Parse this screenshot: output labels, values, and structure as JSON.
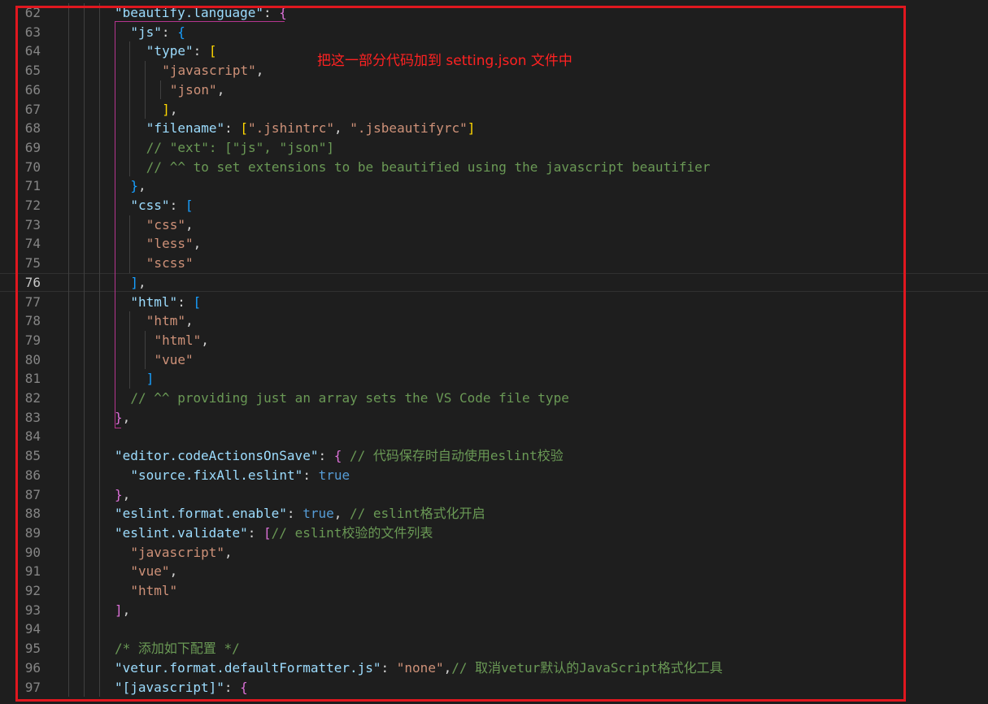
{
  "editor": {
    "current_line": 76,
    "lines": [
      {
        "n": 62,
        "indent": 0,
        "tokens": [
          [
            "k",
            "\"beautify.language\""
          ],
          [
            "p",
            ": "
          ],
          [
            "br2",
            "{"
          ]
        ]
      },
      {
        "n": 63,
        "indent": 1,
        "tokens": [
          [
            "k",
            "\"js\""
          ],
          [
            "p",
            ": "
          ],
          [
            "br3",
            "{"
          ]
        ]
      },
      {
        "n": 64,
        "indent": 2,
        "tokens": [
          [
            "k",
            "\"type\""
          ],
          [
            "p",
            ": "
          ],
          [
            "br1",
            "["
          ]
        ]
      },
      {
        "n": 65,
        "indent": 3,
        "tokens": [
          [
            "s",
            "\"javascript\""
          ],
          [
            "p",
            ","
          ]
        ]
      },
      {
        "n": 66,
        "indent": 3.5,
        "tokens": [
          [
            "s",
            "\"json\""
          ],
          [
            "p",
            ","
          ]
        ]
      },
      {
        "n": 67,
        "indent": 3,
        "tokens": [
          [
            "br1",
            "]"
          ],
          [
            "p",
            ","
          ]
        ]
      },
      {
        "n": 68,
        "indent": 2,
        "tokens": [
          [
            "k",
            "\"filename\""
          ],
          [
            "p",
            ": "
          ],
          [
            "br1",
            "["
          ],
          [
            "s",
            "\".jshintrc\""
          ],
          [
            "p",
            ", "
          ],
          [
            "s",
            "\".jsbeautifyrc\""
          ],
          [
            "br1",
            "]"
          ]
        ]
      },
      {
        "n": 69,
        "indent": 2,
        "tokens": [
          [
            "c",
            "// \"ext\": [\"js\", \"json\"]"
          ]
        ]
      },
      {
        "n": 70,
        "indent": 2,
        "tokens": [
          [
            "c",
            "// ^^ to set extensions to be beautified using the javascript beautifier"
          ]
        ]
      },
      {
        "n": 71,
        "indent": 1,
        "tokens": [
          [
            "br3",
            "}"
          ],
          [
            "p",
            ","
          ]
        ]
      },
      {
        "n": 72,
        "indent": 1,
        "tokens": [
          [
            "k",
            "\"css\""
          ],
          [
            "p",
            ": "
          ],
          [
            "br3",
            "["
          ]
        ]
      },
      {
        "n": 73,
        "indent": 2,
        "tokens": [
          [
            "s",
            "\"css\""
          ],
          [
            "p",
            ","
          ]
        ]
      },
      {
        "n": 74,
        "indent": 2,
        "tokens": [
          [
            "s",
            "\"less\""
          ],
          [
            "p",
            ","
          ]
        ]
      },
      {
        "n": 75,
        "indent": 2,
        "tokens": [
          [
            "s",
            "\"scss\""
          ]
        ]
      },
      {
        "n": 76,
        "indent": 1,
        "tokens": [
          [
            "br3",
            "]"
          ],
          [
            "p",
            ","
          ]
        ]
      },
      {
        "n": 77,
        "indent": 1,
        "tokens": [
          [
            "k",
            "\"html\""
          ],
          [
            "p",
            ": "
          ],
          [
            "br3",
            "["
          ]
        ]
      },
      {
        "n": 78,
        "indent": 2,
        "tokens": [
          [
            "s",
            "\"htm\""
          ],
          [
            "p",
            ","
          ]
        ]
      },
      {
        "n": 79,
        "indent": 2.5,
        "tokens": [
          [
            "s",
            "\"html\""
          ],
          [
            "p",
            ","
          ]
        ]
      },
      {
        "n": 80,
        "indent": 2.5,
        "tokens": [
          [
            "s",
            "\"vue\""
          ]
        ]
      },
      {
        "n": 81,
        "indent": 2,
        "tokens": [
          [
            "br3",
            "]"
          ]
        ]
      },
      {
        "n": 82,
        "indent": 1,
        "tokens": [
          [
            "c",
            "// ^^ providing just an array sets the VS Code file type"
          ]
        ]
      },
      {
        "n": 83,
        "indent": 0,
        "tokens": [
          [
            "br2",
            "}"
          ],
          [
            "p",
            ","
          ]
        ]
      },
      {
        "n": 84,
        "indent": 0,
        "tokens": []
      },
      {
        "n": 85,
        "indent": 0,
        "tokens": [
          [
            "k",
            "\"editor.codeActionsOnSave\""
          ],
          [
            "p",
            ": "
          ],
          [
            "br2",
            "{"
          ],
          [
            "p",
            " "
          ],
          [
            "c",
            "// 代码保存时自动使用eslint校验"
          ]
        ]
      },
      {
        "n": 86,
        "indent": 1,
        "tokens": [
          [
            "k",
            "\"source.fixAll.eslint\""
          ],
          [
            "p",
            ": "
          ],
          [
            "b",
            "true"
          ]
        ]
      },
      {
        "n": 87,
        "indent": 0,
        "tokens": [
          [
            "br2",
            "}"
          ],
          [
            "p",
            ","
          ]
        ]
      },
      {
        "n": 88,
        "indent": 0,
        "tokens": [
          [
            "k",
            "\"eslint.format.enable\""
          ],
          [
            "p",
            ": "
          ],
          [
            "b",
            "true"
          ],
          [
            "p",
            ", "
          ],
          [
            "c",
            "// eslint格式化开启"
          ]
        ]
      },
      {
        "n": 89,
        "indent": 0,
        "tokens": [
          [
            "k",
            "\"eslint.validate\""
          ],
          [
            "p",
            ": "
          ],
          [
            "br2",
            "["
          ],
          [
            "c",
            "// eslint校验的文件列表"
          ]
        ]
      },
      {
        "n": 90,
        "indent": 1,
        "tokens": [
          [
            "s",
            "\"javascript\""
          ],
          [
            "p",
            ","
          ]
        ]
      },
      {
        "n": 91,
        "indent": 1,
        "tokens": [
          [
            "s",
            "\"vue\""
          ],
          [
            "p",
            ","
          ]
        ]
      },
      {
        "n": 92,
        "indent": 1,
        "tokens": [
          [
            "s",
            "\"html\""
          ]
        ]
      },
      {
        "n": 93,
        "indent": 0,
        "tokens": [
          [
            "br2",
            "]"
          ],
          [
            "p",
            ","
          ]
        ]
      },
      {
        "n": 94,
        "indent": 0,
        "tokens": []
      },
      {
        "n": 95,
        "indent": 0,
        "tokens": [
          [
            "c",
            "/* 添加如下配置 */"
          ]
        ]
      },
      {
        "n": 96,
        "indent": 0,
        "tokens": [
          [
            "k",
            "\"vetur.format.defaultFormatter.js\""
          ],
          [
            "p",
            ": "
          ],
          [
            "s",
            "\"none\""
          ],
          [
            "p",
            ","
          ],
          [
            "c",
            "// 取消vetur默认的JavaScript格式化工具"
          ]
        ]
      },
      {
        "n": 97,
        "indent": 0,
        "tokens": [
          [
            "k",
            "\"[javascript]\""
          ],
          [
            "p",
            ": "
          ],
          [
            "br2",
            "{"
          ]
        ]
      }
    ]
  },
  "annotation": {
    "text": "把这一部分代码加到 setting.json 文件中",
    "color": "#ff2222"
  },
  "highlight_box_color": "#e0171f"
}
